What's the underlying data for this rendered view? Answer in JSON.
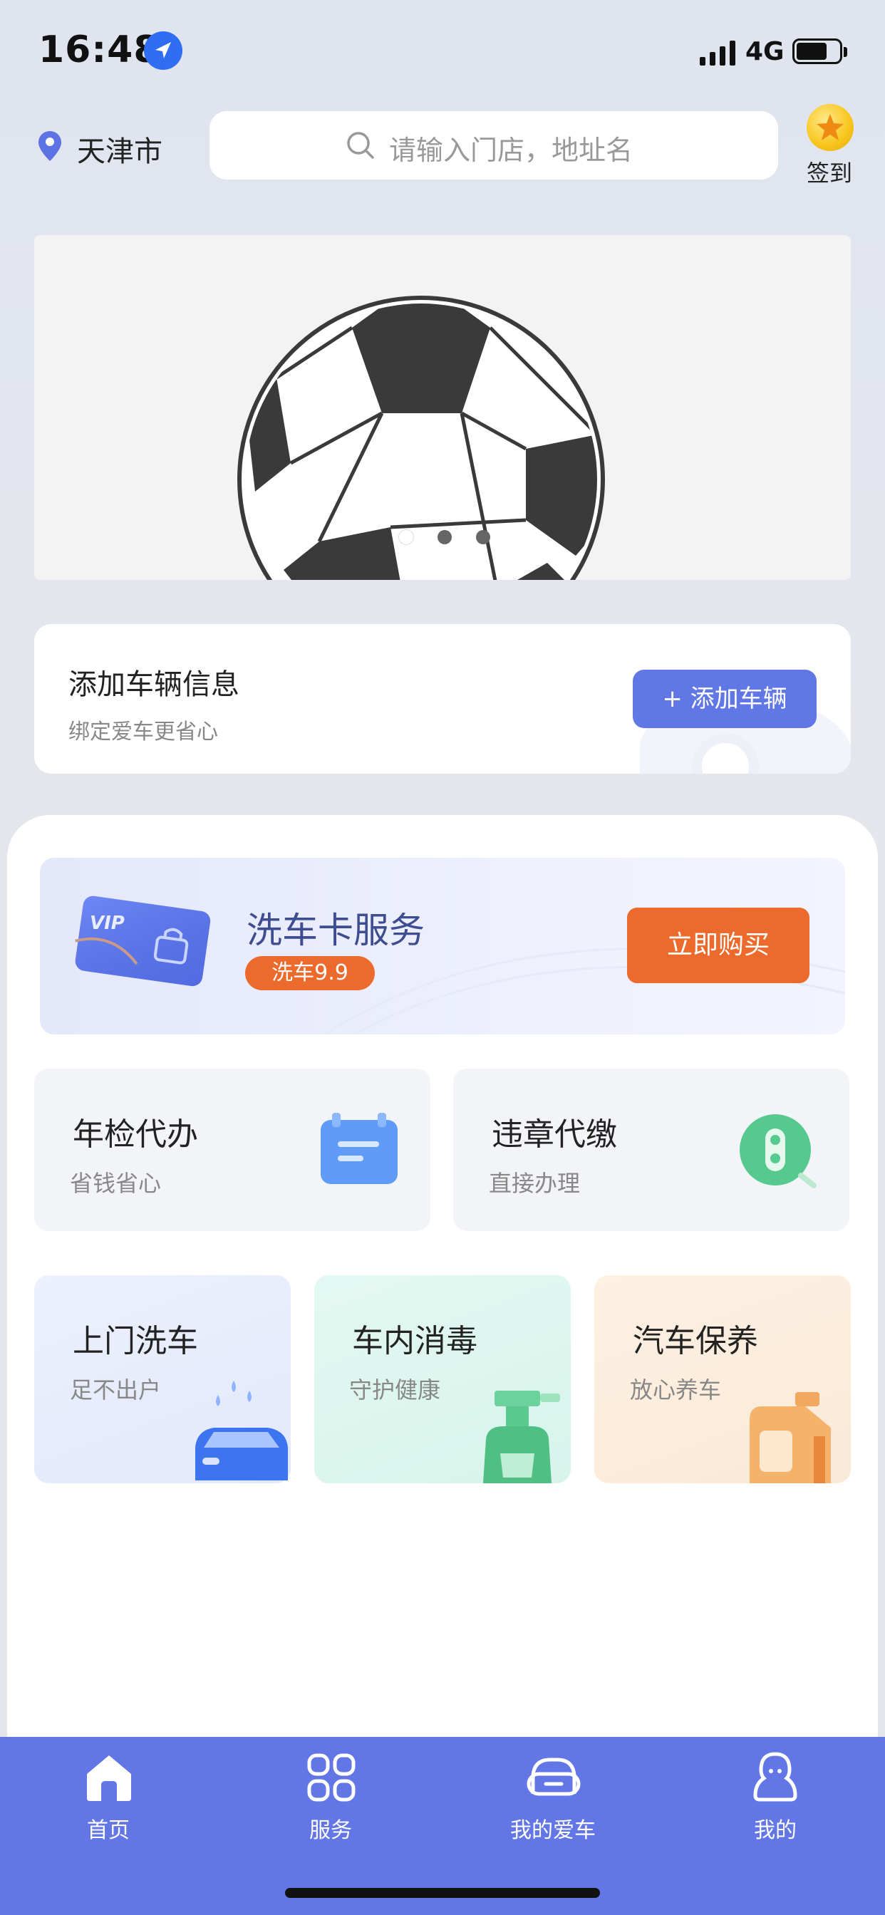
{
  "status_bar": {
    "time": "16:48",
    "network": "4G"
  },
  "header": {
    "city": "天津市",
    "search_placeholder": "请输入门店，地址名",
    "signin_label": "签到"
  },
  "banner": {
    "image": "soccer-ball",
    "pages": 3,
    "active_page": 1
  },
  "add_vehicle": {
    "title": "添加车辆信息",
    "subtitle": "绑定爱车更省心",
    "button": "+ 添加车辆"
  },
  "wash_card": {
    "card_text": "VIP",
    "title": "洗车卡服务",
    "badge": "洗车9.9",
    "button": "立即购买"
  },
  "services": [
    {
      "title": "年检代办",
      "subtitle": "省钱省心",
      "icon": "calendar-icon"
    },
    {
      "title": "违章代缴",
      "subtitle": "直接办理",
      "icon": "traffic-light-icon"
    }
  ],
  "tiles": [
    {
      "title": "上门洗车",
      "subtitle": "足不出户",
      "icon": "car-wash-icon"
    },
    {
      "title": "车内消毒",
      "subtitle": "守护健康",
      "icon": "spray-bottle-icon"
    },
    {
      "title": "汽车保养",
      "subtitle": "放心养车",
      "icon": "oil-can-icon"
    }
  ],
  "tabbar": [
    {
      "label": "首页",
      "icon": "home-icon",
      "active": true
    },
    {
      "label": "服务",
      "icon": "grid-icon",
      "active": false
    },
    {
      "label": "我的爱车",
      "icon": "car-icon",
      "active": false
    },
    {
      "label": "我的",
      "icon": "profile-icon",
      "active": false
    }
  ],
  "colors": {
    "accent": "#6276e5",
    "orange": "#ec6a2c",
    "text": "#222222",
    "muted": "#888888"
  }
}
